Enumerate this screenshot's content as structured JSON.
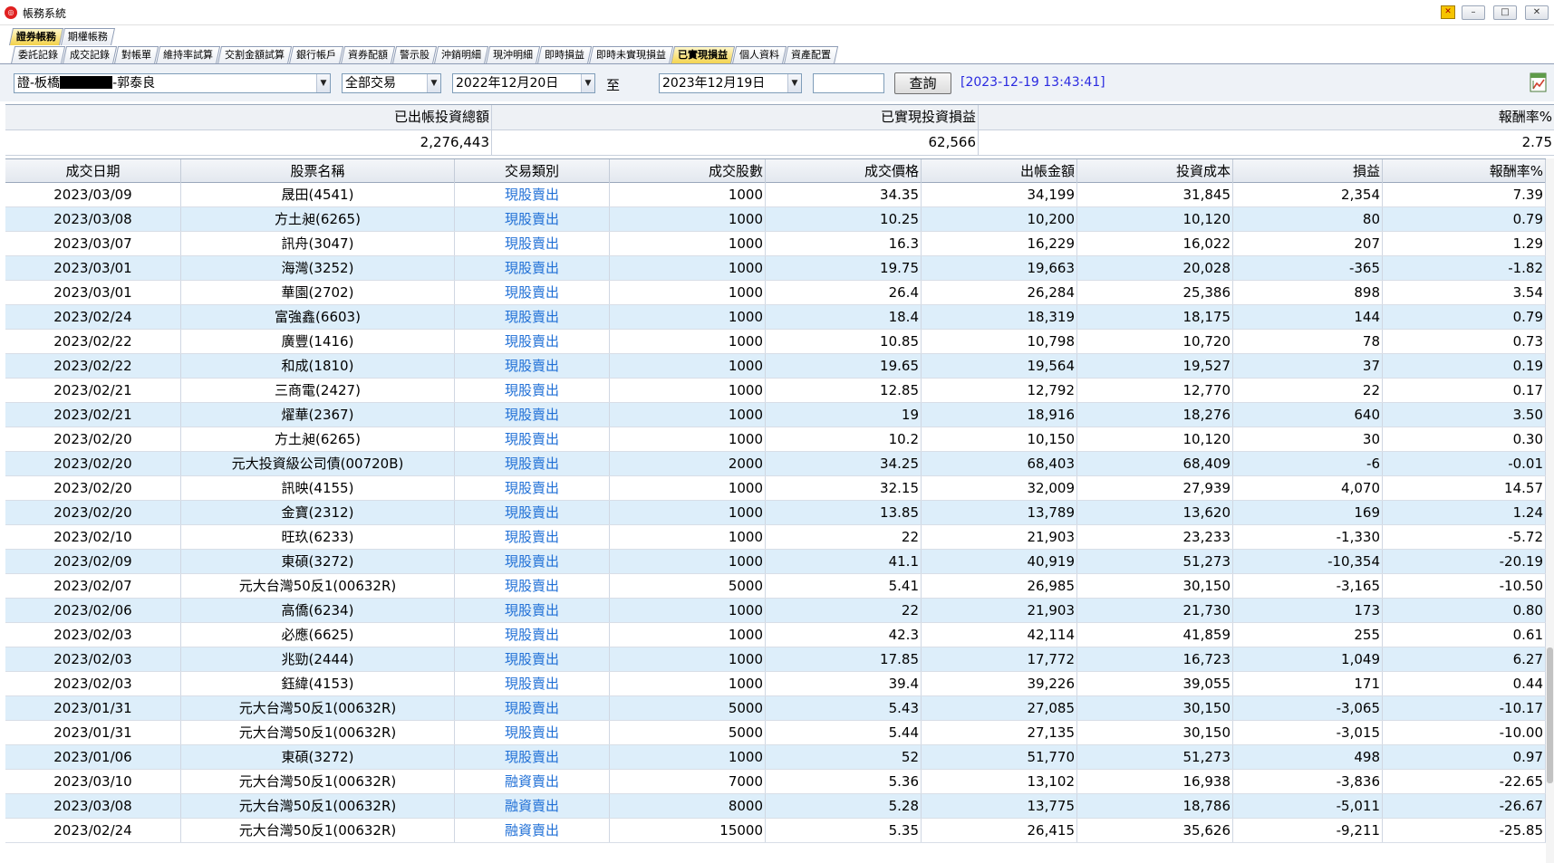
{
  "window": {
    "title": "帳務系統",
    "min": "–",
    "max": "□",
    "close": "✕"
  },
  "tabs_top": [
    {
      "label": "證券帳務",
      "active": true
    },
    {
      "label": "期權帳務",
      "active": false
    }
  ],
  "tabs_sub": [
    {
      "label": "委託記錄",
      "active": false
    },
    {
      "label": "成交記錄",
      "active": false
    },
    {
      "label": "對帳單",
      "active": false
    },
    {
      "label": "維持率試算",
      "active": false
    },
    {
      "label": "交割金額試算",
      "active": false
    },
    {
      "label": "銀行帳戶",
      "active": false
    },
    {
      "label": "資券配額",
      "active": false
    },
    {
      "label": "警示股",
      "active": false
    },
    {
      "label": "沖銷明細",
      "active": false
    },
    {
      "label": "現沖明細",
      "active": false
    },
    {
      "label": "即時損益",
      "active": false
    },
    {
      "label": "即時未實現損益",
      "active": false
    },
    {
      "label": "已實現損益",
      "active": true
    },
    {
      "label": "個人資料",
      "active": false
    },
    {
      "label": "資產配置",
      "active": false
    }
  ],
  "toolbar": {
    "account_prefix": "證-板橋",
    "account_suffix": "-郭泰良",
    "trade_type": "全部交易",
    "start_date": "2022年12月20日",
    "to_label": "至",
    "end_date": "2023年12月19日",
    "extra_input": "",
    "query_label": "查詢",
    "timestamp": "[2023-12-19 13:43:41]"
  },
  "summary": {
    "headers": [
      "已出帳投資總額",
      "已實現投資損益",
      "報酬率%"
    ],
    "values": [
      "2,276,443",
      "62,566",
      "2.75"
    ]
  },
  "table": {
    "columns": [
      "成交日期",
      "股票名稱",
      "交易類別",
      "成交股數",
      "成交價格",
      "出帳金額",
      "投資成本",
      "損益",
      "報酬率%"
    ],
    "rows": [
      [
        "2023/03/09",
        "晟田(4541)",
        "現股賣出",
        "1000",
        "34.35",
        "34,199",
        "31,845",
        "2,354",
        "7.39"
      ],
      [
        "2023/03/08",
        "方土昶(6265)",
        "現股賣出",
        "1000",
        "10.25",
        "10,200",
        "10,120",
        "80",
        "0.79"
      ],
      [
        "2023/03/07",
        "訊舟(3047)",
        "現股賣出",
        "1000",
        "16.3",
        "16,229",
        "16,022",
        "207",
        "1.29"
      ],
      [
        "2023/03/01",
        "海灣(3252)",
        "現股賣出",
        "1000",
        "19.75",
        "19,663",
        "20,028",
        "-365",
        "-1.82"
      ],
      [
        "2023/03/01",
        "華園(2702)",
        "現股賣出",
        "1000",
        "26.4",
        "26,284",
        "25,386",
        "898",
        "3.54"
      ],
      [
        "2023/02/24",
        "富強鑫(6603)",
        "現股賣出",
        "1000",
        "18.4",
        "18,319",
        "18,175",
        "144",
        "0.79"
      ],
      [
        "2023/02/22",
        "廣豐(1416)",
        "現股賣出",
        "1000",
        "10.85",
        "10,798",
        "10,720",
        "78",
        "0.73"
      ],
      [
        "2023/02/22",
        "和成(1810)",
        "現股賣出",
        "1000",
        "19.65",
        "19,564",
        "19,527",
        "37",
        "0.19"
      ],
      [
        "2023/02/21",
        "三商電(2427)",
        "現股賣出",
        "1000",
        "12.85",
        "12,792",
        "12,770",
        "22",
        "0.17"
      ],
      [
        "2023/02/21",
        "燿華(2367)",
        "現股賣出",
        "1000",
        "19",
        "18,916",
        "18,276",
        "640",
        "3.50"
      ],
      [
        "2023/02/20",
        "方土昶(6265)",
        "現股賣出",
        "1000",
        "10.2",
        "10,150",
        "10,120",
        "30",
        "0.30"
      ],
      [
        "2023/02/20",
        "元大投資級公司債(00720B)",
        "現股賣出",
        "2000",
        "34.25",
        "68,403",
        "68,409",
        "-6",
        "-0.01"
      ],
      [
        "2023/02/20",
        "訊映(4155)",
        "現股賣出",
        "1000",
        "32.15",
        "32,009",
        "27,939",
        "4,070",
        "14.57"
      ],
      [
        "2023/02/20",
        "金寶(2312)",
        "現股賣出",
        "1000",
        "13.85",
        "13,789",
        "13,620",
        "169",
        "1.24"
      ],
      [
        "2023/02/10",
        "旺玖(6233)",
        "現股賣出",
        "1000",
        "22",
        "21,903",
        "23,233",
        "-1,330",
        "-5.72"
      ],
      [
        "2023/02/09",
        "東碩(3272)",
        "現股賣出",
        "1000",
        "41.1",
        "40,919",
        "51,273",
        "-10,354",
        "-20.19"
      ],
      [
        "2023/02/07",
        "元大台灣50反1(00632R)",
        "現股賣出",
        "5000",
        "5.41",
        "26,985",
        "30,150",
        "-3,165",
        "-10.50"
      ],
      [
        "2023/02/06",
        "高僑(6234)",
        "現股賣出",
        "1000",
        "22",
        "21,903",
        "21,730",
        "173",
        "0.80"
      ],
      [
        "2023/02/03",
        "必應(6625)",
        "現股賣出",
        "1000",
        "42.3",
        "42,114",
        "41,859",
        "255",
        "0.61"
      ],
      [
        "2023/02/03",
        "兆勁(2444)",
        "現股賣出",
        "1000",
        "17.85",
        "17,772",
        "16,723",
        "1,049",
        "6.27"
      ],
      [
        "2023/02/03",
        "鈺緯(4153)",
        "現股賣出",
        "1000",
        "39.4",
        "39,226",
        "39,055",
        "171",
        "0.44"
      ],
      [
        "2023/01/31",
        "元大台灣50反1(00632R)",
        "現股賣出",
        "5000",
        "5.43",
        "27,085",
        "30,150",
        "-3,065",
        "-10.17"
      ],
      [
        "2023/01/31",
        "元大台灣50反1(00632R)",
        "現股賣出",
        "5000",
        "5.44",
        "27,135",
        "30,150",
        "-3,015",
        "-10.00"
      ],
      [
        "2023/01/06",
        "東碩(3272)",
        "現股賣出",
        "1000",
        "52",
        "51,770",
        "51,273",
        "498",
        "0.97"
      ],
      [
        "2023/03/10",
        "元大台灣50反1(00632R)",
        "融資賣出",
        "7000",
        "5.36",
        "13,102",
        "16,938",
        "-3,836",
        "-22.65"
      ],
      [
        "2023/03/08",
        "元大台灣50反1(00632R)",
        "融資賣出",
        "8000",
        "5.28",
        "13,775",
        "18,786",
        "-5,011",
        "-26.67"
      ],
      [
        "2023/02/24",
        "元大台灣50反1(00632R)",
        "融資賣出",
        "15000",
        "5.35",
        "26,415",
        "35,626",
        "-9,211",
        "-25.85"
      ]
    ]
  },
  "icons": {
    "export": "excel-export-icon",
    "logo": "app-logo-icon"
  },
  "colors": {
    "link": "#1f6fd6",
    "alt_row": "#ddeefa",
    "active_tab": "#f3d24a",
    "timestamp": "#2a2ae0"
  }
}
